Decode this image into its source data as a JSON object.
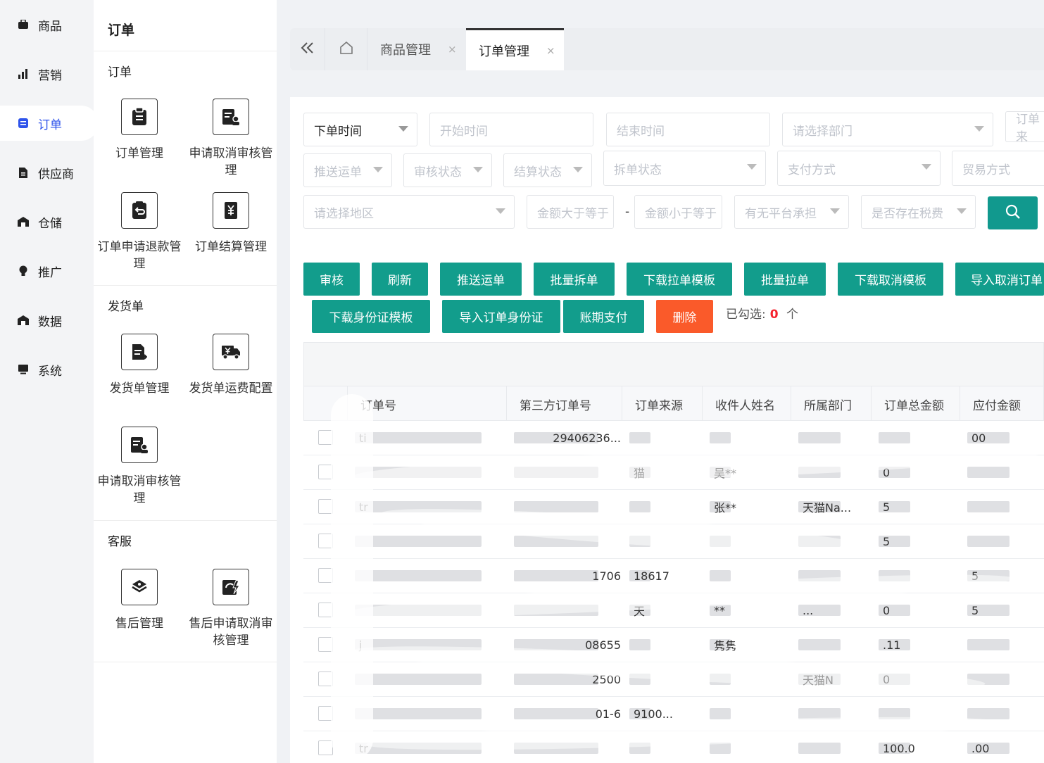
{
  "nav1": [
    {
      "label": "商品",
      "icon": "bag-icon"
    },
    {
      "label": "营销",
      "icon": "bar-chart-icon"
    },
    {
      "label": "订单",
      "icon": "order-icon"
    },
    {
      "label": "供应商",
      "icon": "supplier-icon"
    },
    {
      "label": "仓储",
      "icon": "warehouse-icon"
    },
    {
      "label": "推广",
      "icon": "bulb-icon"
    },
    {
      "label": "数据",
      "icon": "data-icon"
    },
    {
      "label": "系统",
      "icon": "monitor-icon"
    }
  ],
  "nav2": {
    "title": "订单",
    "sections": [
      {
        "title": "订单",
        "tiles": [
          "订单管理",
          "申请取消审核管理",
          "订单申请退款管理",
          "订单结算管理"
        ]
      },
      {
        "title": "发货单",
        "tiles": [
          "发货单管理",
          "发货单运费配置",
          "申请取消审核管理"
        ]
      },
      {
        "title": "客服",
        "tiles": [
          "售后管理",
          "售后申请取消审核管理"
        ]
      }
    ]
  },
  "tabs": [
    {
      "label": "商品管理",
      "close": "×"
    },
    {
      "label": "订单管理",
      "close": "×"
    }
  ],
  "filters": {
    "order_time": "下单时间",
    "start_time": "开始时间",
    "end_time": "结束时间",
    "dept": "请选择部门",
    "order_src": "订单来",
    "push": "推送运单",
    "audit": "审核状态",
    "settle": "结算状态",
    "split": "拆单状态",
    "pay": "支付方式",
    "trade": "贸易方式",
    "region": "请选择地区",
    "amount_min": "金额大于等于",
    "dash": "-",
    "amount_max": "金额小于等于",
    "platform": "有无平台承担",
    "tax": "是否存在税费"
  },
  "actions": {
    "audit": "审核",
    "refresh": "刷新",
    "push": "推送运单",
    "batch_split": "批量拆单",
    "dl_pull_tpl": "下载拉单模板",
    "batch_pull": "批量拉单",
    "dl_cancel_tpl": "下载取消模板",
    "import_cancel": "导入取消订单",
    "dl_id_tpl": "下载身份证模板",
    "import_id": "导入订单身份证",
    "period_pay": "账期支付",
    "delete": "删除",
    "selected_prefix": "已勾选:",
    "selected_count": "0",
    "selected_suffix": "个"
  },
  "table": {
    "headers": [
      "订单号",
      "第三方订单号",
      "订单来源",
      "收件人姓名",
      "所属部门",
      "订单总金额",
      "应付金额"
    ],
    "rows": [
      [
        "ti",
        "29406236...",
        "",
        "",
        "",
        "",
        "00"
      ],
      [
        "",
        "",
        "猫",
        "吴**",
        "",
        "0",
        ""
      ],
      [
        "tr",
        "",
        "",
        "张**",
        "天猫Na...",
        "5",
        ""
      ],
      [
        "",
        "",
        "",
        "",
        "",
        "5",
        ""
      ],
      [
        "",
        "1706",
        "18617",
        "",
        "",
        "",
        "5"
      ],
      [
        "",
        "",
        "天",
        "**",
        "...",
        "0",
        "5"
      ],
      [
        "j",
        "08655",
        "",
        "隽隽",
        "",
        ".11",
        ""
      ],
      [
        "",
        "2500",
        "",
        "",
        "天猫N",
        "0",
        ""
      ],
      [
        "",
        "01-6",
        "9100...",
        "",
        "",
        "",
        ""
      ],
      [
        "tr",
        "",
        "",
        "",
        "",
        "100.0",
        ".00"
      ]
    ]
  }
}
